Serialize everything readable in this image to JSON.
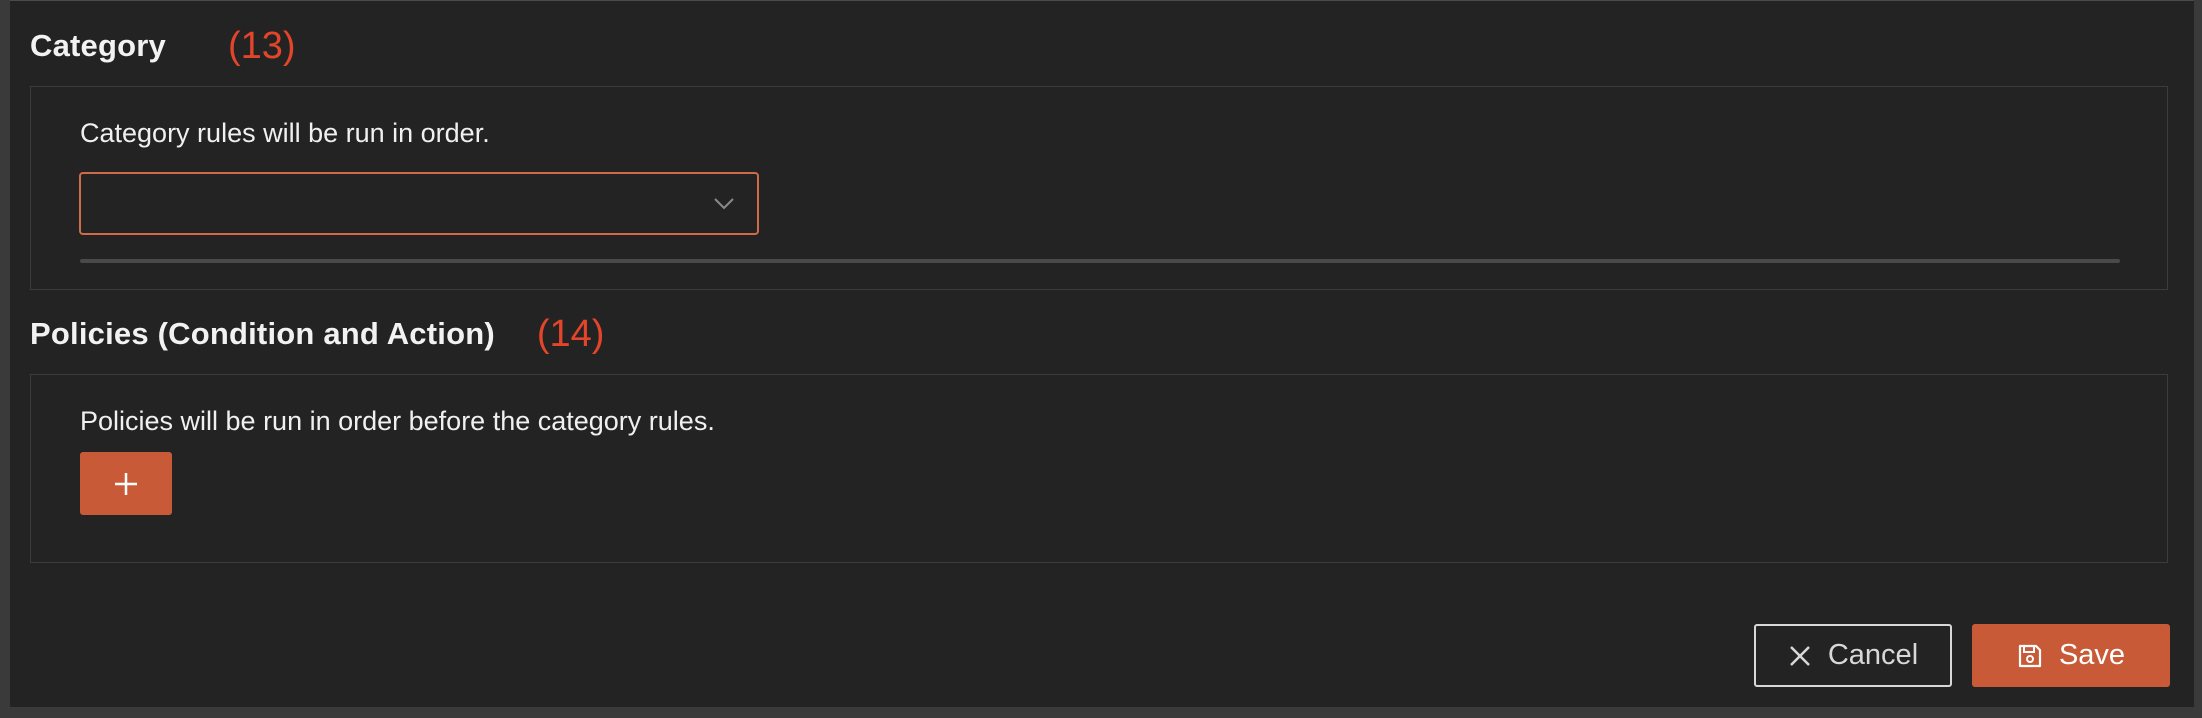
{
  "category_section": {
    "title": "Category",
    "annotation": "(13)",
    "help_text": "Category rules will be run in order.",
    "select_value": ""
  },
  "policies_section": {
    "title": "Policies (Condition and Action)",
    "annotation": "(14)",
    "help_text": "Policies will be run in order before the category rules.",
    "add_label": "+"
  },
  "footer": {
    "cancel_label": "Cancel",
    "save_label": "Save"
  },
  "colors": {
    "accent": "#c95a38",
    "annotation": "#e2452a",
    "background": "#232323"
  },
  "icons": {
    "select": "chevron-down-icon",
    "cancel": "close-icon",
    "save": "floppy-disk-icon",
    "add": "plus-icon"
  }
}
